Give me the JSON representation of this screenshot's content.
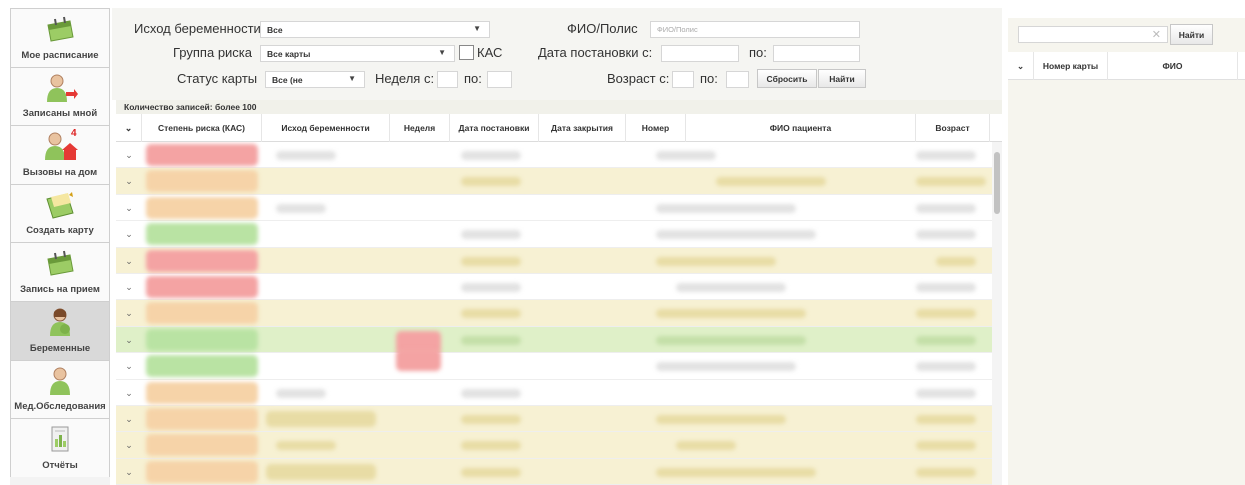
{
  "sidebar": {
    "items": [
      {
        "label": "Мое расписание",
        "icon": "calendar-icon"
      },
      {
        "label": "Записаны мной",
        "icon": "doctor-arrow-icon"
      },
      {
        "label": "Вызовы на дом",
        "icon": "doctor-house-icon",
        "badge": "4"
      },
      {
        "label": "Создать карту",
        "icon": "folder-add-icon"
      },
      {
        "label": "Запись на прием",
        "icon": "calendar-icon"
      },
      {
        "label": "Беременные",
        "icon": "pregnant-woman-icon"
      },
      {
        "label": "Мед.Обследования",
        "icon": "doctor-icon"
      },
      {
        "label": "Отчёты",
        "icon": "report-icon"
      }
    ],
    "active_index": 5
  },
  "filters": {
    "outcome_label": "Исход беременности",
    "outcome_value": "Все",
    "risk_group_label": "Группа риска",
    "risk_group_value": "Все карты",
    "kas_label": "КАС",
    "card_status_label": "Статус карты",
    "card_status_value": "Все (не",
    "week_from_label": "Неделя с:",
    "week_to_label": "по:",
    "fio_label": "ФИО/Полис",
    "fio_placeholder": "ФИО/Полис",
    "date_from_label": "Дата постановки с:",
    "date_to_label": "по:",
    "age_from_label": "Возраст с:",
    "age_to_label": "по:",
    "reset_button": "Сбросить",
    "find_button": "Найти"
  },
  "table": {
    "count_text": "Количество записей: более 100",
    "columns": [
      "Степень риска (КАС)",
      "Исход беременности",
      "Неделя",
      "Дата постановки",
      "Дата закрытия",
      "Номер",
      "ФИО пациента",
      "Возраст"
    ],
    "row_count": 13
  },
  "right_panel": {
    "find_button": "Найти",
    "columns": [
      "Номер карты",
      "ФИО"
    ]
  },
  "colors": {
    "row_white": "#ffffff",
    "row_yellow": "#f7f1d3",
    "row_green": "#dff0c8",
    "risk_red": "#f4a3a3",
    "risk_green": "#b9e3a3",
    "risk_orange": "#f6d3a8"
  }
}
